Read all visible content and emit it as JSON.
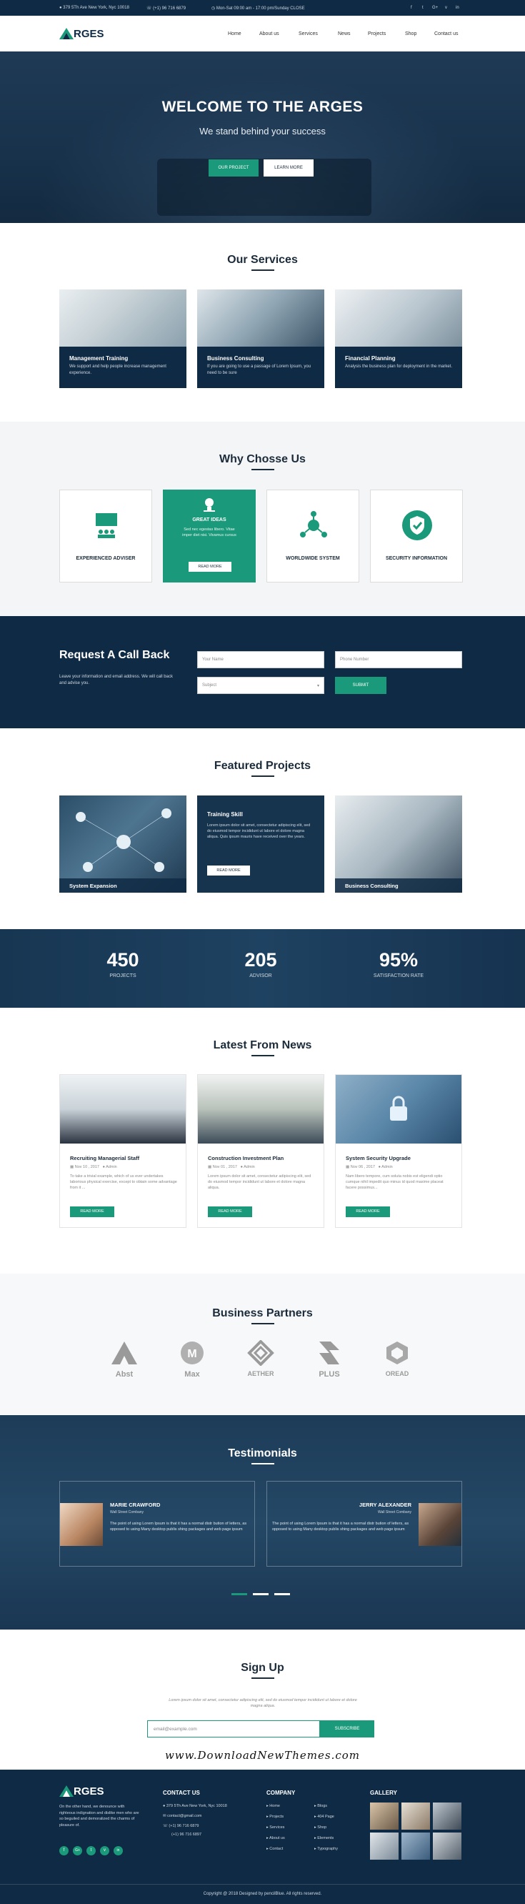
{
  "topbar": {
    "address": "379 5Th Ave New York, Nyc 10018",
    "phone": "(+1) 96 716 6879",
    "hours": "Mon-Sat 09:00 am - 17:00 pm/Sunday CLOSE",
    "social": [
      "f",
      "t",
      "G+",
      "v",
      "in"
    ]
  },
  "header": {
    "logo": "RGES",
    "nav": [
      "Home",
      "About us",
      "Services",
      "News",
      "Projects",
      "Shop",
      "Contact us"
    ]
  },
  "hero": {
    "title": "WELCOME TO THE ARGES",
    "subtitle": "We stand behind your success",
    "btn_primary": "OUR PROJECT",
    "btn_secondary": "LEARN MORE"
  },
  "services": {
    "title": "Our Services",
    "items": [
      {
        "title": "Management Training",
        "desc": "We support and help people increase management experience."
      },
      {
        "title": "Business Consulting",
        "desc": "If you are going to use a passage of Lorem Ipsum, you need to be sure"
      },
      {
        "title": "Financial Planning",
        "desc": "Analysis the business plan for deployment in the market."
      }
    ]
  },
  "why": {
    "title": "Why Chosse Us",
    "items": [
      {
        "title": "EXPERIENCED ADVISER"
      },
      {
        "title": "GREAT IDEAS",
        "desc": "Sed nec egestas libero. Vitae imper diet nisi. Vivamus cursus",
        "btn": "READ MORE"
      },
      {
        "title": "WORLDWIDE SYSTEM"
      },
      {
        "title": "SECURITY INFORMATION"
      }
    ]
  },
  "callback": {
    "title": "Request A Call Back",
    "desc": "Leave your information and email address. We will call back and advise you.",
    "name_ph": "Your Name",
    "phone_ph": "Phone Number",
    "subject_ph": "Subject",
    "submit": "SUBMIT"
  },
  "projects": {
    "title": "Featured Projects",
    "items": [
      {
        "title": "System Expansion"
      },
      {
        "title": "Training Skill",
        "desc": "Lorem ipsum dolor sit amet, consectetur adipiscing elit, sed do eiusmod tempor incididunt ut labore et dolore magna aliqua. Quis ipsum mauris have received over the years.",
        "btn": "READ MORE"
      },
      {
        "title": "Business Consulting"
      }
    ]
  },
  "stats": [
    {
      "value": "450",
      "label": "PROJECTS"
    },
    {
      "value": "205",
      "label": "ADVISOR"
    },
    {
      "value": "95%",
      "label": "SATISFACTION RATE"
    }
  ],
  "news": {
    "title": "Latest From News",
    "items": [
      {
        "title": "Recruiting Managerial Staff",
        "date": "Nov 10 , 2017",
        "author": "Admin",
        "desc": "To take a trivial example, which of us ever undertakes laborious physical exercise, except to obtain some advantage from it ...",
        "btn": "READ MORE"
      },
      {
        "title": "Construction Investment Plan",
        "date": "Nov 01 , 2017",
        "author": "Admin",
        "desc": "Lorem ipsum dolor sit amet, consectetur adipiscing elit, sed do eiusmod tempor incididunt ut labore et dolore magna aliqua.",
        "btn": "READ MORE"
      },
      {
        "title": "System Security Upgrade",
        "date": "Nov 06 , 2017",
        "author": "Admin",
        "desc": "Nam libero tempore, cum soluta nobis est eligendi optio cumque nihil impedit quo minus id quod maxime placeat facere possimus...",
        "btn": "READ MORE"
      }
    ]
  },
  "partners": {
    "title": "Business Partners",
    "items": [
      "Abst",
      "Max",
      "AETHER",
      "PLUS",
      "OREAD"
    ]
  },
  "testimonials": {
    "title": "Testimonials",
    "items": [
      {
        "name": "MARIE CRAWFORD",
        "company": "Wall Street Combany",
        "text": "The point of using Lorem Ipsum is that it has a normal distr bution of letters, as opposed to using Many desktop publis shing packages and web page ipsum"
      },
      {
        "name": "JERRY ALEXANDER",
        "company": "Wall Street Combany",
        "text": "The point of using Lorem Ipsum is that it has a normal distr bution of letters, as opposed to using Many desktop publis shing packages and web page ipsum"
      }
    ]
  },
  "signup": {
    "title": "Sign Up",
    "desc": "Lorem ipsum dolor sit amet, consectetur adipiscing elit, sed do eiusmod tempor incididunt ut labore et dolore magna aliqua.",
    "email_ph": "email@example.com",
    "btn": "SUBSCRIBE"
  },
  "watermark": "www.DownloadNewThemes.com",
  "footer": {
    "logo": "RGES",
    "about": "On the other hand, we denounce with righteous indignation and dislike men who are so beguiled and demoralized the charms of pleasure of.",
    "social": [
      "f",
      "G+",
      "t",
      "v",
      "in"
    ],
    "contact_title": "CONTACT US",
    "contact": [
      "379 5Th Ave New York, Nyc 10018",
      "contact@gmail.com",
      "(+1) 96 716 6879",
      "(+1) 96 716 6897"
    ],
    "company_title": "COMPANY",
    "company_col1": [
      "Home",
      "Projects",
      "Services",
      "About us",
      "Contact"
    ],
    "company_col2": [
      "Blogs",
      "404 Page",
      "Shop",
      "Elements",
      "Typography"
    ],
    "gallery_title": "GALLERY",
    "copyright": "Copyright @ 2018 Designed by pencilBlue. All rights reserved."
  }
}
